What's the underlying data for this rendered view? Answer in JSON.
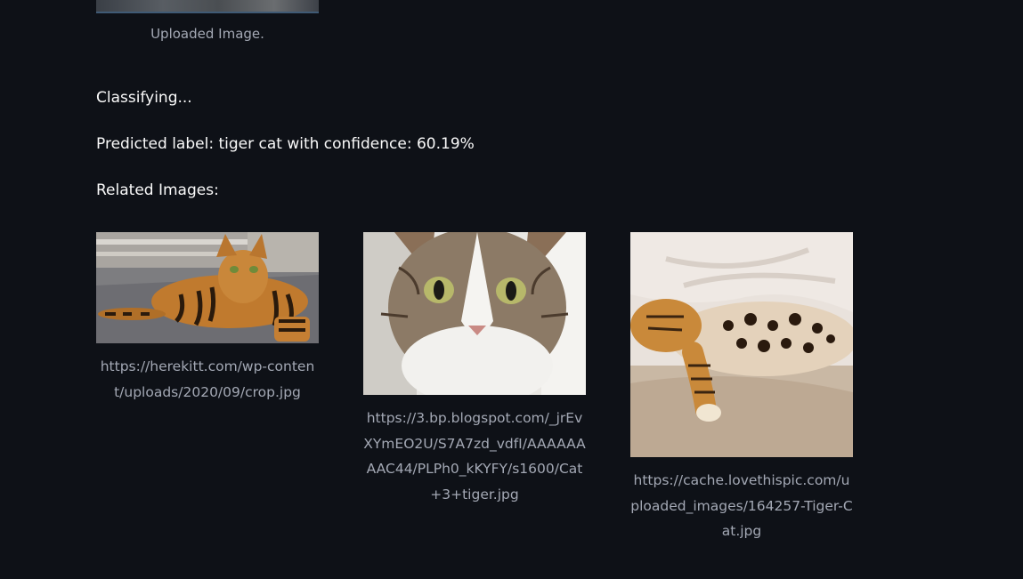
{
  "uploaded": {
    "caption": "Uploaded Image."
  },
  "status": {
    "classifying": "Classifying...",
    "prediction": "Predicted label: tiger cat with confidence: 60.19%",
    "related_heading": "Related Images:"
  },
  "related_images": [
    {
      "url": "https://herekitt.com/wp-content/uploads/2020/09/crop.jpg"
    },
    {
      "url": "https://3.bp.blogspot.com/_jrEvXYmEO2U/S7A7zd_vdfI/AAAAAAAAC44/PLPh0_kKYFY/s1600/Cat+3+tiger.jpg"
    },
    {
      "url": "https://cache.lovethispic.com/uploaded_images/164257-Tiger-Cat.jpg"
    }
  ],
  "colors": {
    "background": "#0e1117",
    "text_primary": "#fafafa",
    "text_caption": "#a3a8b4"
  }
}
